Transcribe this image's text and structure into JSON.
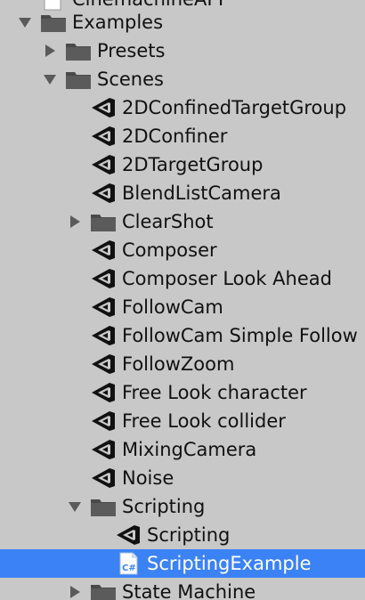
{
  "panel": {
    "rows": [
      {
        "label": "CinemachineAPI",
        "icon": "document-icon"
      },
      {
        "label": "Examples",
        "icon": "folder-icon",
        "state": "expanded"
      },
      {
        "label": "Presets",
        "icon": "folder-icon",
        "state": "collapsed"
      },
      {
        "label": "Scenes",
        "icon": "folder-icon",
        "state": "expanded"
      },
      {
        "label": "2DConfinedTargetGroup",
        "icon": "unity-scene-icon"
      },
      {
        "label": "2DConfiner",
        "icon": "unity-scene-icon"
      },
      {
        "label": "2DTargetGroup",
        "icon": "unity-scene-icon"
      },
      {
        "label": "BlendListCamera",
        "icon": "unity-scene-icon"
      },
      {
        "label": "ClearShot",
        "icon": "folder-icon",
        "state": "collapsed"
      },
      {
        "label": "Composer",
        "icon": "unity-scene-icon"
      },
      {
        "label": "Composer Look Ahead",
        "icon": "unity-scene-icon"
      },
      {
        "label": "FollowCam",
        "icon": "unity-scene-icon"
      },
      {
        "label": "FollowCam Simple Follow",
        "icon": "unity-scene-icon"
      },
      {
        "label": "FollowZoom",
        "icon": "unity-scene-icon"
      },
      {
        "label": "Free Look character",
        "icon": "unity-scene-icon"
      },
      {
        "label": "Free Look collider",
        "icon": "unity-scene-icon"
      },
      {
        "label": "MixingCamera",
        "icon": "unity-scene-icon"
      },
      {
        "label": "Noise",
        "icon": "unity-scene-icon"
      },
      {
        "label": "Scripting",
        "icon": "folder-icon",
        "state": "expanded"
      },
      {
        "label": "Scripting",
        "icon": "unity-scene-icon"
      },
      {
        "label": "ScriptingExample",
        "icon": "csharp-script-icon",
        "selected": true
      },
      {
        "label": "State Machine",
        "icon": "folder-icon",
        "state": "collapsed"
      }
    ]
  },
  "colors": {
    "background": "#c8c8c8",
    "selection": "#3b82f6",
    "folder": "#4a4a4a",
    "text": "#111111"
  }
}
